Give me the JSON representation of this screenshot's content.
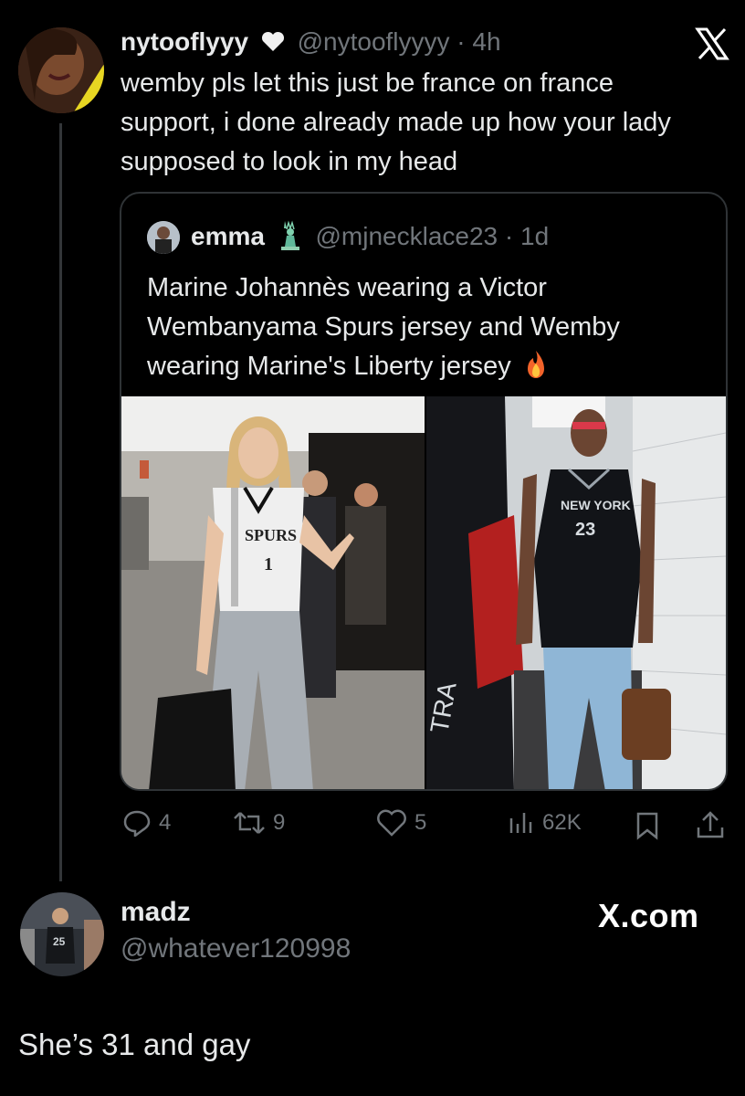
{
  "tweet": {
    "display_name": "nytooflyyy",
    "handle": "@nytooflyyyy",
    "separator": "·",
    "time": "4h",
    "text": "wemby pls let this just be france on france support, i done already made up how your lady supposed to look in my head"
  },
  "quote": {
    "display_name": "emma",
    "handle": "@mjnecklace23",
    "separator": "·",
    "time": "1d",
    "text": "Marine Johannès wearing a Victor Wembanyama Spurs jersey and Wemby wearing Marine's Liberty jersey",
    "photo_left": {
      "jersey_text": "SPURS",
      "jersey_number": "1"
    },
    "photo_right": {
      "jersey_text": "NEW YORK",
      "jersey_number": "23",
      "wall_text": "TRA"
    }
  },
  "actions": {
    "replies": "4",
    "reposts": "9",
    "likes": "5",
    "views": "62K"
  },
  "reply_author": {
    "display_name": "madz",
    "handle": "@whatever120998",
    "avatar_jersey": "25"
  },
  "xcom": "X.com",
  "reply_text": "She’s 31 and gay",
  "icons": [
    "heart-icon",
    "x-logo-icon",
    "statue-of-liberty-icon",
    "fire-icon",
    "reply-icon",
    "repost-icon",
    "like-icon",
    "views-icon",
    "bookmark-icon",
    "share-icon"
  ]
}
